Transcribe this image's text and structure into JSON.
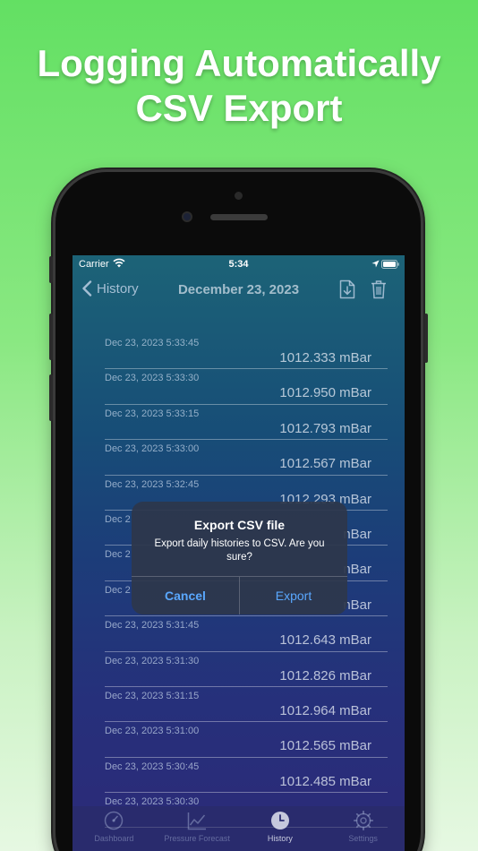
{
  "headline": {
    "line1": "Logging Automatically",
    "line2": "CSV Export"
  },
  "status_bar": {
    "carrier": "Carrier",
    "time": "5:34"
  },
  "nav": {
    "back_label": "History",
    "title": "December 23, 2023"
  },
  "history": [
    {
      "date": "Dec 23, 2023 5:33:45",
      "value": "1012.333 mBar"
    },
    {
      "date": "Dec 23, 2023 5:33:30",
      "value": "1012.950 mBar"
    },
    {
      "date": "Dec 23, 2023 5:33:15",
      "value": "1012.793 mBar"
    },
    {
      "date": "Dec 23, 2023 5:33:00",
      "value": "1012.567 mBar"
    },
    {
      "date": "Dec 23, 2023 5:32:45",
      "value": "1012.293 mBar"
    },
    {
      "date": "Dec 2",
      "value": "nBar"
    },
    {
      "date": "Dec 2",
      "value": "nBar"
    },
    {
      "date": "Dec 2",
      "value": "nBar"
    },
    {
      "date": "Dec 23, 2023 5:31:45",
      "value": "1012.643 mBar"
    },
    {
      "date": "Dec 23, 2023 5:31:30",
      "value": "1012.826 mBar"
    },
    {
      "date": "Dec 23, 2023 5:31:15",
      "value": "1012.964 mBar"
    },
    {
      "date": "Dec 23, 2023 5:31:00",
      "value": "1012.565 mBar"
    },
    {
      "date": "Dec 23, 2023 5:30:45",
      "value": "1012.485 mBar"
    },
    {
      "date": "Dec 23, 2023 5:30:30",
      "value": ""
    }
  ],
  "dialog": {
    "title": "Export CSV file",
    "message": "Export daily histories to CSV. Are you sure?",
    "cancel_label": "Cancel",
    "export_label": "Export"
  },
  "tabs": [
    {
      "label": "Dashboard",
      "icon": "gauge-icon",
      "active": false
    },
    {
      "label": "Pressure Forecast",
      "icon": "chart-line-icon",
      "active": false
    },
    {
      "label": "History",
      "icon": "clock-icon",
      "active": true
    },
    {
      "label": "Settings",
      "icon": "gear-icon",
      "active": false
    }
  ],
  "colors": {
    "accent_link": "#5aa8ff",
    "background_green": "#63e063"
  }
}
